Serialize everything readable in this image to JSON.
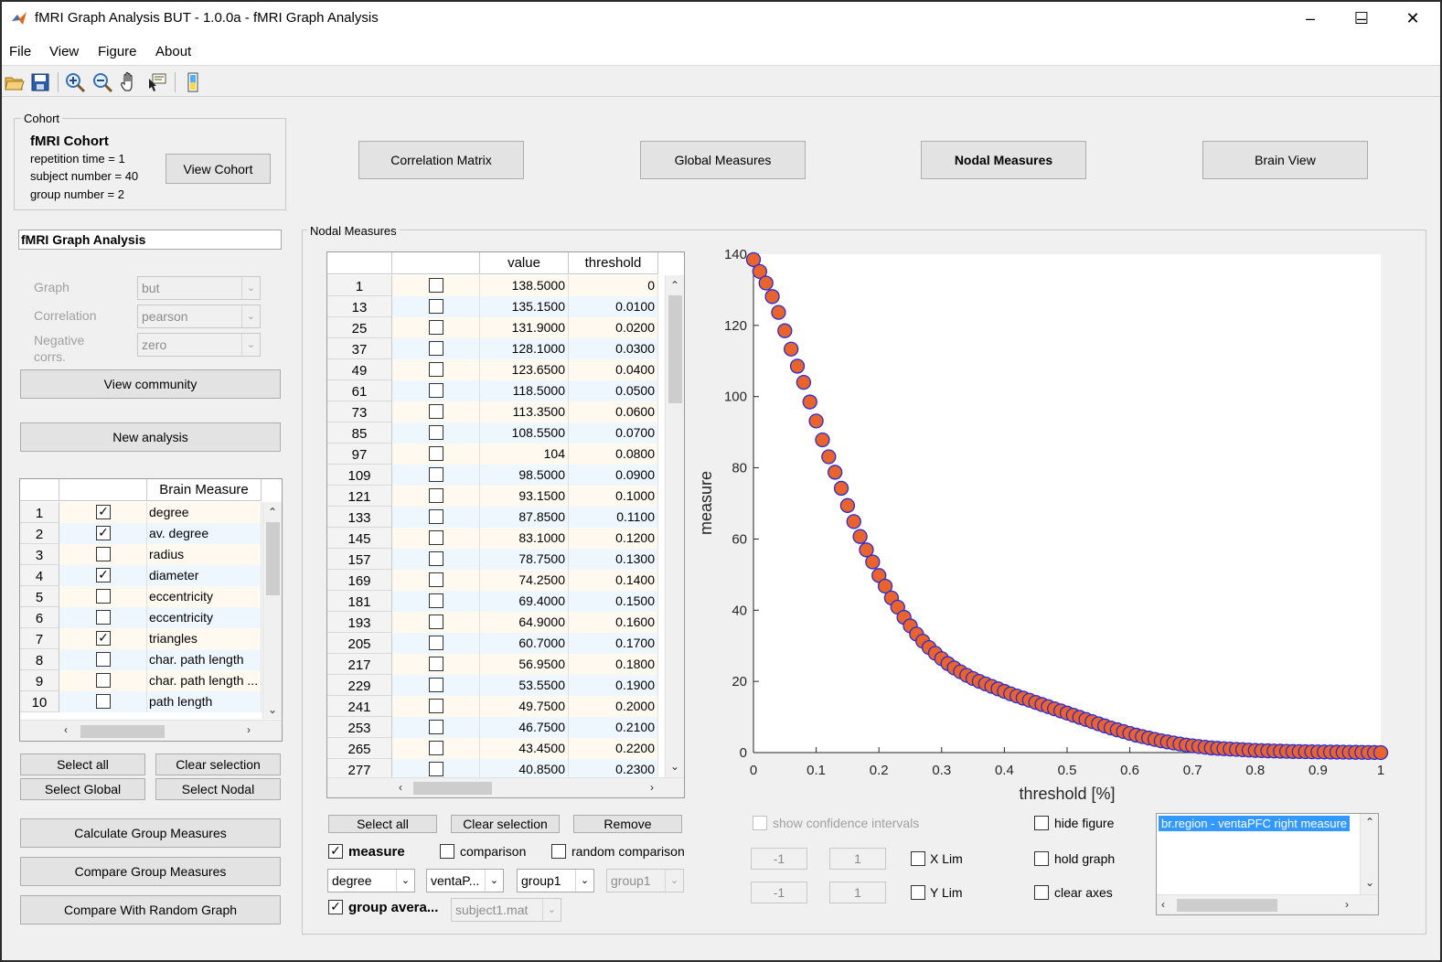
{
  "window": {
    "title": "fMRI Graph Analysis BUT - 1.0.0a - fMRI Graph Analysis",
    "controls": {
      "minimize": "–",
      "maximize": "☐",
      "close": "✕"
    }
  },
  "menu": [
    "File",
    "View",
    "Figure",
    "About"
  ],
  "toolbar_icons": [
    "open-folder-icon",
    "save-icon",
    "zoom-in-icon",
    "zoom-out-icon",
    "pan-hand-icon",
    "data-cursor-icon",
    "colorbar-icon"
  ],
  "cohort": {
    "legend": "Cohort",
    "name": "fMRI Cohort",
    "repetition": "repetition time = 1",
    "subjects": "subject number = 40",
    "groups": "group number = 2",
    "view_button": "View Cohort"
  },
  "tabs": [
    "Correlation Matrix",
    "Global Measures",
    "Nodal Measures",
    "Brain View"
  ],
  "analysis": {
    "name": "fMRI Graph Analysis",
    "graph_label": "Graph",
    "graph_value": "but",
    "correlation_label": "Correlation",
    "correlation_value": "pearson",
    "negative_label_1": "Negative",
    "negative_label_2": "corrs.",
    "negative_value": "zero",
    "view_community": "View community",
    "new_analysis": "New analysis"
  },
  "measures_table": {
    "header": "Brain Measure",
    "rows": [
      {
        "idx": "1",
        "checked": true,
        "name": "degree"
      },
      {
        "idx": "2",
        "checked": true,
        "name": "av. degree"
      },
      {
        "idx": "3",
        "checked": false,
        "name": "radius"
      },
      {
        "idx": "4",
        "checked": true,
        "name": "diameter"
      },
      {
        "idx": "5",
        "checked": false,
        "name": "eccentricity"
      },
      {
        "idx": "6",
        "checked": false,
        "name": "eccentricity"
      },
      {
        "idx": "7",
        "checked": true,
        "name": "triangles"
      },
      {
        "idx": "8",
        "checked": false,
        "name": "char. path length"
      },
      {
        "idx": "9",
        "checked": false,
        "name": "char. path length ..."
      },
      {
        "idx": "10",
        "checked": false,
        "name": "path length"
      }
    ]
  },
  "measure_buttons": {
    "select_all": "Select all",
    "clear_selection": "Clear selection",
    "select_global": "Select Global",
    "select_nodal": "Select Nodal",
    "calculate": "Calculate Group Measures",
    "compare": "Compare Group Measures",
    "compare_random": "Compare With Random Graph"
  },
  "nodal": {
    "legend": "Nodal Measures",
    "col_value": "value",
    "col_threshold": "threshold",
    "rows": [
      {
        "idx": "1",
        "value": "138.5000",
        "threshold": "0"
      },
      {
        "idx": "13",
        "value": "135.1500",
        "threshold": "0.0100"
      },
      {
        "idx": "25",
        "value": "131.9000",
        "threshold": "0.0200"
      },
      {
        "idx": "37",
        "value": "128.1000",
        "threshold": "0.0300"
      },
      {
        "idx": "49",
        "value": "123.6500",
        "threshold": "0.0400"
      },
      {
        "idx": "61",
        "value": "118.5000",
        "threshold": "0.0500"
      },
      {
        "idx": "73",
        "value": "113.3500",
        "threshold": "0.0600"
      },
      {
        "idx": "85",
        "value": "108.5500",
        "threshold": "0.0700"
      },
      {
        "idx": "97",
        "value": "104",
        "threshold": "0.0800"
      },
      {
        "idx": "109",
        "value": "98.5000",
        "threshold": "0.0900"
      },
      {
        "idx": "121",
        "value": "93.1500",
        "threshold": "0.1000"
      },
      {
        "idx": "133",
        "value": "87.8500",
        "threshold": "0.1100"
      },
      {
        "idx": "145",
        "value": "83.1000",
        "threshold": "0.1200"
      },
      {
        "idx": "157",
        "value": "78.7500",
        "threshold": "0.1300"
      },
      {
        "idx": "169",
        "value": "74.2500",
        "threshold": "0.1400"
      },
      {
        "idx": "181",
        "value": "69.4000",
        "threshold": "0.1500"
      },
      {
        "idx": "193",
        "value": "64.9000",
        "threshold": "0.1600"
      },
      {
        "idx": "205",
        "value": "60.7000",
        "threshold": "0.1700"
      },
      {
        "idx": "217",
        "value": "56.9500",
        "threshold": "0.1800"
      },
      {
        "idx": "229",
        "value": "53.5500",
        "threshold": "0.1900"
      },
      {
        "idx": "241",
        "value": "49.7500",
        "threshold": "0.2000"
      },
      {
        "idx": "253",
        "value": "46.7500",
        "threshold": "0.2100"
      },
      {
        "idx": "265",
        "value": "43.4500",
        "threshold": "0.2200"
      },
      {
        "idx": "277",
        "value": "40.8500",
        "threshold": "0.2300"
      }
    ],
    "select_all": "Select all",
    "clear_selection": "Clear selection",
    "remove": "Remove",
    "measure_label": "measure",
    "comparison_label": "comparison",
    "random_comparison_label": "random comparison",
    "dd_measure": "degree",
    "dd_region": "ventaP...",
    "dd_group": "group1",
    "dd_group2": "group1",
    "group_average_label": "group avera...",
    "dd_subject": "subject1.mat"
  },
  "plot_controls": {
    "show_ci": "show confidence intervals",
    "xlim_min": "-1",
    "xlim_max": "1",
    "xlim_label": "X Lim",
    "ylim_min": "-1",
    "ylim_max": "1",
    "ylim_label": "Y Lim",
    "hide_figure": "hide figure",
    "hold_graph": "hold graph",
    "clear_axes": "clear axes",
    "list_selected": "br.region - ventaPFC right measure"
  },
  "chart_data": {
    "type": "scatter",
    "xlabel": "threshold [%]",
    "ylabel": "measure",
    "xlim": [
      0,
      1
    ],
    "ylim": [
      0,
      140
    ],
    "xticks": [
      "0",
      "0.1",
      "0.2",
      "0.3",
      "0.4",
      "0.5",
      "0.6",
      "0.7",
      "0.8",
      "0.9",
      "1"
    ],
    "yticks": [
      "0",
      "20",
      "40",
      "60",
      "80",
      "100",
      "120",
      "140"
    ],
    "marker_fill": "#e8642c",
    "marker_edge": "#2b2bd6",
    "series": [
      {
        "x": [
          0,
          0.01,
          0.02,
          0.03,
          0.04,
          0.05,
          0.06,
          0.07,
          0.08,
          0.09,
          0.1,
          0.11,
          0.12,
          0.13,
          0.14,
          0.15,
          0.16,
          0.17,
          0.18,
          0.19,
          0.2,
          0.21,
          0.22,
          0.23,
          0.24,
          0.25,
          0.26,
          0.27,
          0.28,
          0.29,
          0.3,
          0.31,
          0.32,
          0.33,
          0.34,
          0.35,
          0.36,
          0.37,
          0.38,
          0.39,
          0.4,
          0.41,
          0.42,
          0.43,
          0.44,
          0.45,
          0.46,
          0.47,
          0.48,
          0.49,
          0.5,
          0.51,
          0.52,
          0.53,
          0.54,
          0.55,
          0.56,
          0.57,
          0.58,
          0.59,
          0.6,
          0.61,
          0.62,
          0.63,
          0.64,
          0.65,
          0.66,
          0.67,
          0.68,
          0.69,
          0.7,
          0.71,
          0.72,
          0.73,
          0.74,
          0.75,
          0.76,
          0.77,
          0.78,
          0.79,
          0.8,
          0.81,
          0.82,
          0.83,
          0.84,
          0.85,
          0.86,
          0.87,
          0.88,
          0.89,
          0.9,
          0.91,
          0.92,
          0.93,
          0.94,
          0.95,
          0.96,
          0.97,
          0.98,
          0.99,
          1.0
        ],
        "y": [
          138.5,
          135.15,
          131.9,
          128.1,
          123.65,
          118.5,
          113.35,
          108.55,
          104,
          98.5,
          93.15,
          87.85,
          83.1,
          78.75,
          74.25,
          69.4,
          64.9,
          60.7,
          56.95,
          53.55,
          49.75,
          46.75,
          43.45,
          40.85,
          38.0,
          35.6,
          33.3,
          31.3,
          29.5,
          27.9,
          26.4,
          25.0,
          23.8,
          22.7,
          21.7,
          20.8,
          20.0,
          19.3,
          18.6,
          17.9,
          17.2,
          16.5,
          15.9,
          15.3,
          14.7,
          14.1,
          13.5,
          12.9,
          12.3,
          11.7,
          11.1,
          10.5,
          9.9,
          9.3,
          8.7,
          8.1,
          7.5,
          6.9,
          6.4,
          5.9,
          5.4,
          4.9,
          4.5,
          4.1,
          3.7,
          3.3,
          3.0,
          2.7,
          2.4,
          2.1,
          1.9,
          1.7,
          1.5,
          1.3,
          1.2,
          1.1,
          1.0,
          0.9,
          0.8,
          0.7,
          0.6,
          0.55,
          0.5,
          0.45,
          0.4,
          0.35,
          0.3,
          0.28,
          0.25,
          0.22,
          0.2,
          0.18,
          0.16,
          0.14,
          0.12,
          0.1,
          0.08,
          0.06,
          0.04,
          0.02,
          0.0
        ]
      }
    ]
  }
}
